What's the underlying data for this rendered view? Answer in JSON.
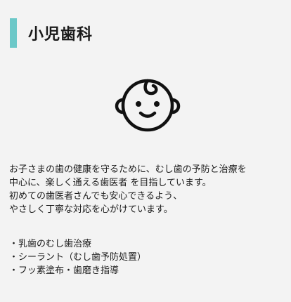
{
  "section": {
    "title": "小児歯科",
    "accent_color": "#6cc8c8",
    "icon": "baby-face-icon"
  },
  "description": {
    "lines": [
      "お子さまの歯の健康を守るために、むし歯の予防と治療を",
      "中心に、楽しく通える歯医者 を目指しています。",
      "初めての歯医者さんでも安心できるよう、",
      "やさしく丁寧な対応を心がけています。"
    ]
  },
  "services": {
    "items": [
      "・乳歯のむし歯治療",
      "・シーラント（むし歯予防処置）",
      "・フッ素塗布・歯磨き指導"
    ]
  }
}
